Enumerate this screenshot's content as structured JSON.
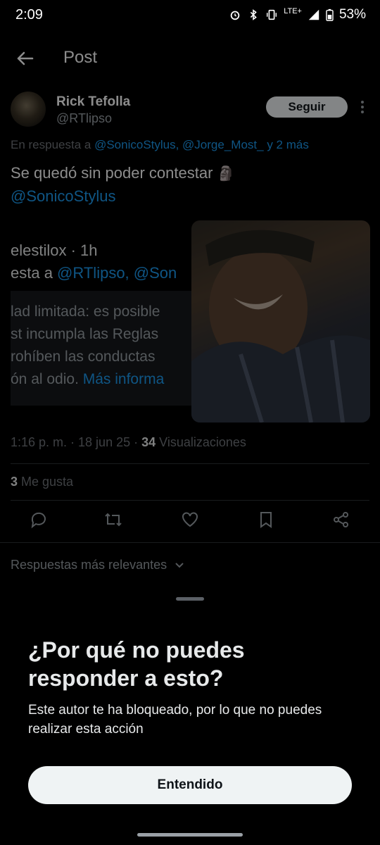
{
  "status_bar": {
    "time": "2:09",
    "network": "LTE+",
    "battery": "53%"
  },
  "header": {
    "title": "Post",
    "back_icon": "arrow-left-icon"
  },
  "post": {
    "author_name": "Rick Tefolla",
    "author_handle": "@RTlipso",
    "follow_label": "Seguir",
    "reply_prefix": "En respuesta a ",
    "reply_users": "@SonicoStylus, @Jorge_Most_",
    "reply_more": " y 2 más",
    "text": "Se quedó sin poder contestar",
    "emoji": "🗿",
    "mention": "@SonicoStylus",
    "quoted": {
      "user_line": "elestilox · 1h",
      "reply_prefix": "esta a ",
      "reply_users": "@RTlipso, @Son",
      "notice_lines": [
        "lad limitada: es posible",
        "st incumpla las Reglas",
        "rohíben las conductas"
      ],
      "notice_last": "ón al odio. ",
      "notice_link": "Más informa"
    },
    "timestamp": "1:16 p. m. · 18 jun 25 · ",
    "views_count": "34",
    "views_label": " Visualizaciones",
    "likes_count": "3",
    "likes_label": " Me gusta"
  },
  "sort": {
    "label": "Respuestas más relevantes"
  },
  "sheet": {
    "title": "¿Por qué no puedes responder a esto?",
    "body": "Este autor te ha bloqueado, por lo que no puedes realizar esta acción",
    "button": "Entendido"
  }
}
